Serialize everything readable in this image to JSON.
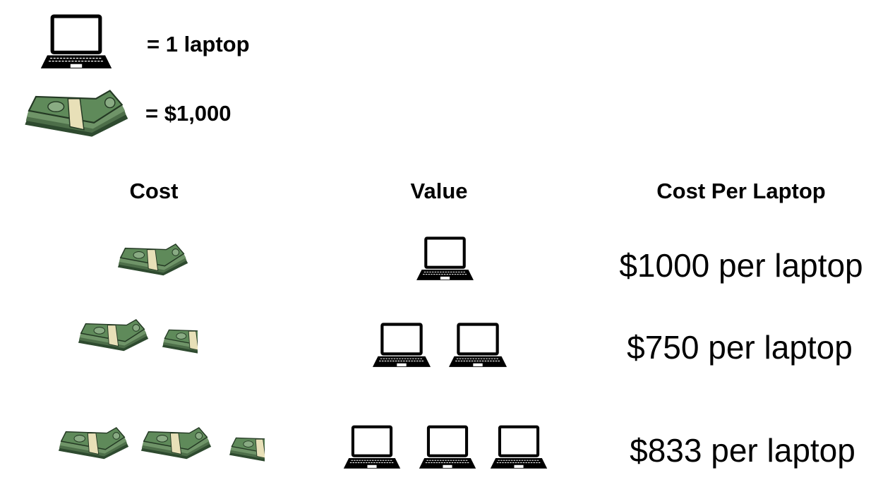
{
  "legend": {
    "laptop_label": "= 1 laptop",
    "money_label": "= $1,000",
    "laptop_icon": "laptop-icon",
    "money_icon": "money-stack-icon"
  },
  "headers": {
    "cost": "Cost",
    "value": "Value",
    "cost_per_laptop": "Cost Per Laptop"
  },
  "rows": [
    {
      "cost_stacks": 1,
      "laptops": 1,
      "cost_per_laptop": "$1000 per laptop"
    },
    {
      "cost_stacks": 1.5,
      "laptops": 2,
      "cost_per_laptop": "$750 per laptop"
    },
    {
      "cost_stacks": 2.5,
      "laptops": 3,
      "cost_per_laptop": "$833 per laptop"
    }
  ],
  "colors": {
    "money_green": "#5f8a5a",
    "money_dark": "#2e4a2f",
    "band": "#e8e0b8",
    "laptop": "#000000"
  }
}
